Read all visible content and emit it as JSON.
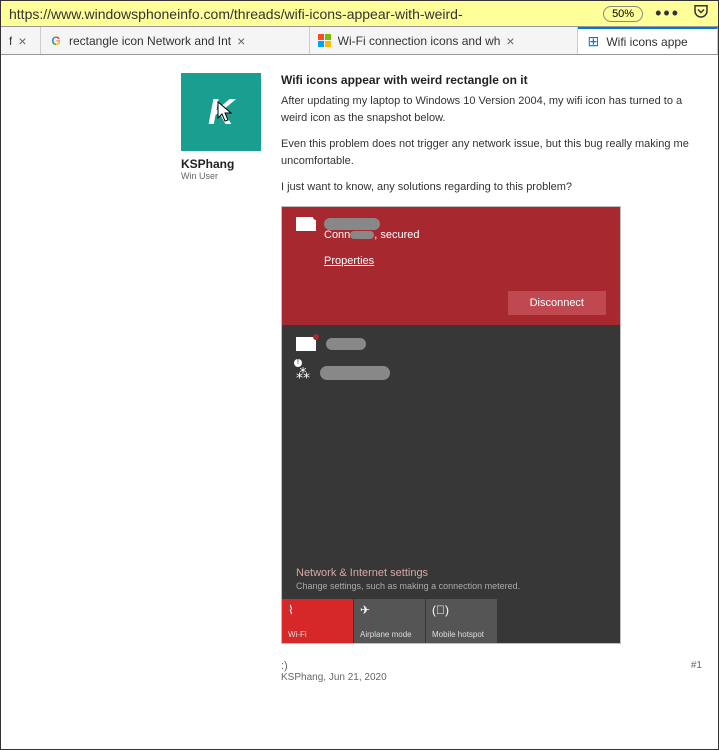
{
  "url_bar": {
    "url": "https://www.windowsphoneinfo.com/threads/wifi-icons-appear-with-weird-",
    "zoom": "50%"
  },
  "tabs": [
    {
      "label": "f",
      "favicon": "generic"
    },
    {
      "label": "rectangle icon Network and Int",
      "favicon": "google"
    },
    {
      "label": "Wi-Fi connection icons and wh",
      "favicon": "microsoft"
    },
    {
      "label": "Wifi icons appe",
      "favicon": "windows",
      "active": true
    }
  ],
  "post": {
    "author": "KSPhang",
    "author_title": "Win User",
    "avatar_letter": "K",
    "title": "Wifi icons appear with weird rectangle on it",
    "paragraphs": [
      "After updating my laptop to Windows 10 Version 2004, my wifi icon has turned to a weird icon as the snapshot below.",
      "Even this problem does not trigger any network issue, but this bug really making me uncomfortable.",
      "I just want to know, any solutions regarding to this problem?"
    ],
    "smiley": ":)",
    "footer": "KSPhang, Jun 21, 2020",
    "post_num": "#1"
  },
  "screenshot": {
    "status_text": ", secured",
    "connected_prefix": "Conn",
    "properties": "Properties",
    "disconnect": "Disconnect",
    "net_settings": "Network & Internet settings",
    "net_sub": "Change settings, such as making a connection metered.",
    "tiles": [
      {
        "label": "Wi-Fi",
        "icon": "wifi",
        "color": "red"
      },
      {
        "label": "Airplane mode",
        "icon": "plane",
        "color": "grey"
      },
      {
        "label": "Mobile hotspot",
        "icon": "hotspot",
        "color": "grey"
      }
    ]
  }
}
